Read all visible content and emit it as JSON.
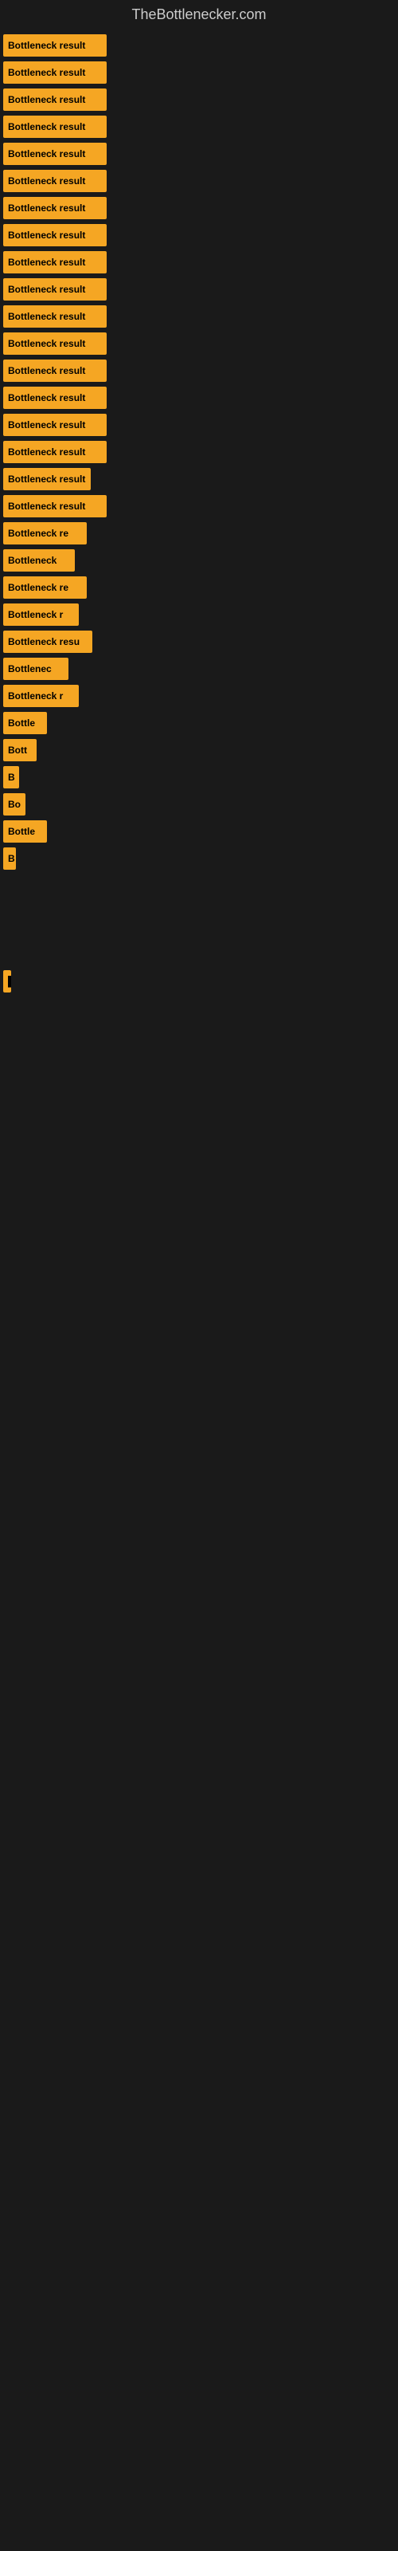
{
  "header": {
    "title": "TheBottlenecker.com"
  },
  "bars": [
    {
      "label": "Bottleneck result",
      "width": 130
    },
    {
      "label": "Bottleneck result",
      "width": 130
    },
    {
      "label": "Bottleneck result",
      "width": 130
    },
    {
      "label": "Bottleneck result",
      "width": 130
    },
    {
      "label": "Bottleneck result",
      "width": 130
    },
    {
      "label": "Bottleneck result",
      "width": 130
    },
    {
      "label": "Bottleneck result",
      "width": 130
    },
    {
      "label": "Bottleneck result",
      "width": 130
    },
    {
      "label": "Bottleneck result",
      "width": 130
    },
    {
      "label": "Bottleneck result",
      "width": 130
    },
    {
      "label": "Bottleneck result",
      "width": 130
    },
    {
      "label": "Bottleneck result",
      "width": 130
    },
    {
      "label": "Bottleneck result",
      "width": 130
    },
    {
      "label": "Bottleneck result",
      "width": 130
    },
    {
      "label": "Bottleneck result",
      "width": 130
    },
    {
      "label": "Bottleneck result",
      "width": 130
    },
    {
      "label": "Bottleneck result",
      "width": 110
    },
    {
      "label": "Bottleneck result",
      "width": 130
    },
    {
      "label": "Bottleneck re",
      "width": 105
    },
    {
      "label": "Bottleneck",
      "width": 90
    },
    {
      "label": "Bottleneck re",
      "width": 105
    },
    {
      "label": "Bottleneck r",
      "width": 95
    },
    {
      "label": "Bottleneck resu",
      "width": 112
    },
    {
      "label": "Bottlenec",
      "width": 82
    },
    {
      "label": "Bottleneck r",
      "width": 95
    },
    {
      "label": "Bottle",
      "width": 55
    },
    {
      "label": "Bott",
      "width": 42
    },
    {
      "label": "B",
      "width": 20
    },
    {
      "label": "Bo",
      "width": 28
    },
    {
      "label": "Bottle",
      "width": 55
    },
    {
      "label": "B",
      "width": 16
    },
    {
      "label": "",
      "width": 0
    },
    {
      "label": "",
      "width": 0
    },
    {
      "label": "",
      "width": 0
    },
    {
      "label": "▌",
      "width": 10
    },
    {
      "label": "",
      "width": 0
    },
    {
      "label": "",
      "width": 0
    },
    {
      "label": "",
      "width": 0
    },
    {
      "label": "",
      "width": 0
    },
    {
      "label": "",
      "width": 0
    }
  ]
}
